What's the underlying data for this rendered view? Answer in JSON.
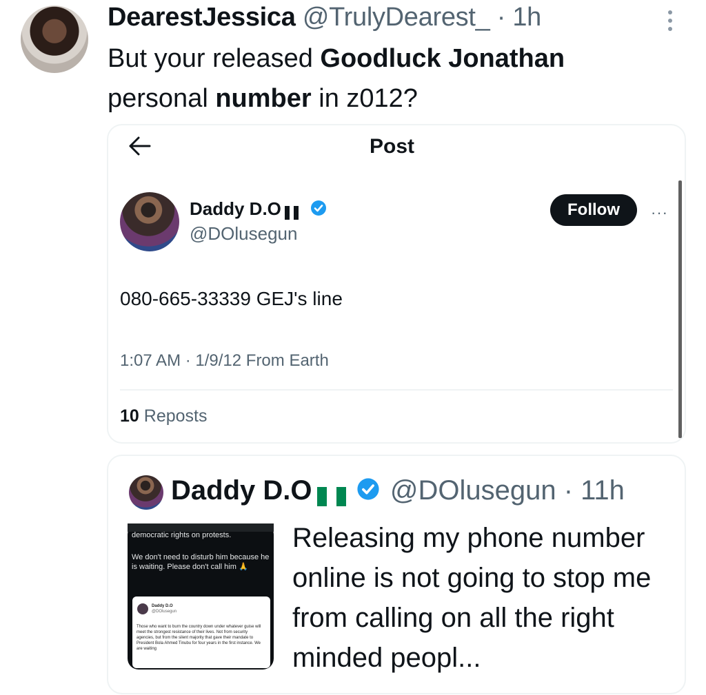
{
  "tweet": {
    "name": "DearestJessica",
    "handle": "@TrulyDearest_",
    "time": "· 1h",
    "text_1": "But your released ",
    "text_bold_1": "Goodluck Jonathan",
    "text_2": "personal ",
    "text_bold_2": "number",
    "text_3": " in z012?"
  },
  "post_card": {
    "title": "Post",
    "name": "Daddy D.O",
    "handle": "@DOlusegun",
    "follow_label": "Follow",
    "more": "···",
    "body": "080-665-33339 GEJ's line",
    "meta": "1:07 AM · 1/9/12 From Earth",
    "reposts_count": "10",
    "reposts_label": " Reposts"
  },
  "quote": {
    "name": "Daddy D.O",
    "handle": "@DOlusegun",
    "time": "· 11h",
    "text": "Releasing my phone number online is not going to stop me from calling on all the right minded peopl...",
    "media": {
      "line_top": "democratic rights on protests.",
      "line_2": "We don't need to disturb him because he is waiting. Please don't call him 🙏",
      "inner_name": "Daddy D.O",
      "inner_handle": "@DOlusegun",
      "inner_text": "Those who want to burn the country down under whatever guise will meet the strongest resistance of their lives. Not from security agencies, but from the silent majority that gave their mandate to President Bola Ahmed Tinubu for four years in the first instance. We are waiting"
    }
  },
  "colors": {
    "text": "#0f1419",
    "secondary": "#536471",
    "verified": "#1d9bf0",
    "flag_green": "#008751",
    "follow_bg": "#0f1419"
  },
  "icons": [
    "more-vertical-icon",
    "back-arrow-icon",
    "verified-badge-icon",
    "nigeria-flag-icon",
    "more-horizontal-icon"
  ]
}
